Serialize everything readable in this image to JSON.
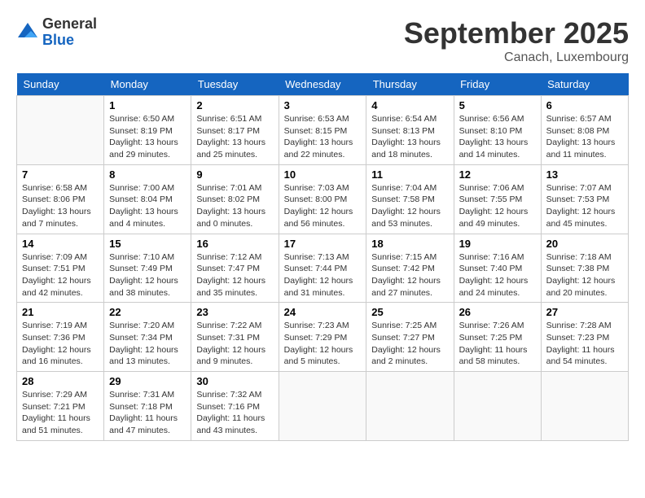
{
  "header": {
    "logo_general": "General",
    "logo_blue": "Blue",
    "month_title": "September 2025",
    "location": "Canach, Luxembourg"
  },
  "days_of_week": [
    "Sunday",
    "Monday",
    "Tuesday",
    "Wednesday",
    "Thursday",
    "Friday",
    "Saturday"
  ],
  "weeks": [
    [
      {
        "day": "",
        "info": ""
      },
      {
        "day": "1",
        "info": "Sunrise: 6:50 AM\nSunset: 8:19 PM\nDaylight: 13 hours\nand 29 minutes."
      },
      {
        "day": "2",
        "info": "Sunrise: 6:51 AM\nSunset: 8:17 PM\nDaylight: 13 hours\nand 25 minutes."
      },
      {
        "day": "3",
        "info": "Sunrise: 6:53 AM\nSunset: 8:15 PM\nDaylight: 13 hours\nand 22 minutes."
      },
      {
        "day": "4",
        "info": "Sunrise: 6:54 AM\nSunset: 8:13 PM\nDaylight: 13 hours\nand 18 minutes."
      },
      {
        "day": "5",
        "info": "Sunrise: 6:56 AM\nSunset: 8:10 PM\nDaylight: 13 hours\nand 14 minutes."
      },
      {
        "day": "6",
        "info": "Sunrise: 6:57 AM\nSunset: 8:08 PM\nDaylight: 13 hours\nand 11 minutes."
      }
    ],
    [
      {
        "day": "7",
        "info": "Sunrise: 6:58 AM\nSunset: 8:06 PM\nDaylight: 13 hours\nand 7 minutes."
      },
      {
        "day": "8",
        "info": "Sunrise: 7:00 AM\nSunset: 8:04 PM\nDaylight: 13 hours\nand 4 minutes."
      },
      {
        "day": "9",
        "info": "Sunrise: 7:01 AM\nSunset: 8:02 PM\nDaylight: 13 hours\nand 0 minutes."
      },
      {
        "day": "10",
        "info": "Sunrise: 7:03 AM\nSunset: 8:00 PM\nDaylight: 12 hours\nand 56 minutes."
      },
      {
        "day": "11",
        "info": "Sunrise: 7:04 AM\nSunset: 7:58 PM\nDaylight: 12 hours\nand 53 minutes."
      },
      {
        "day": "12",
        "info": "Sunrise: 7:06 AM\nSunset: 7:55 PM\nDaylight: 12 hours\nand 49 minutes."
      },
      {
        "day": "13",
        "info": "Sunrise: 7:07 AM\nSunset: 7:53 PM\nDaylight: 12 hours\nand 45 minutes."
      }
    ],
    [
      {
        "day": "14",
        "info": "Sunrise: 7:09 AM\nSunset: 7:51 PM\nDaylight: 12 hours\nand 42 minutes."
      },
      {
        "day": "15",
        "info": "Sunrise: 7:10 AM\nSunset: 7:49 PM\nDaylight: 12 hours\nand 38 minutes."
      },
      {
        "day": "16",
        "info": "Sunrise: 7:12 AM\nSunset: 7:47 PM\nDaylight: 12 hours\nand 35 minutes."
      },
      {
        "day": "17",
        "info": "Sunrise: 7:13 AM\nSunset: 7:44 PM\nDaylight: 12 hours\nand 31 minutes."
      },
      {
        "day": "18",
        "info": "Sunrise: 7:15 AM\nSunset: 7:42 PM\nDaylight: 12 hours\nand 27 minutes."
      },
      {
        "day": "19",
        "info": "Sunrise: 7:16 AM\nSunset: 7:40 PM\nDaylight: 12 hours\nand 24 minutes."
      },
      {
        "day": "20",
        "info": "Sunrise: 7:18 AM\nSunset: 7:38 PM\nDaylight: 12 hours\nand 20 minutes."
      }
    ],
    [
      {
        "day": "21",
        "info": "Sunrise: 7:19 AM\nSunset: 7:36 PM\nDaylight: 12 hours\nand 16 minutes."
      },
      {
        "day": "22",
        "info": "Sunrise: 7:20 AM\nSunset: 7:34 PM\nDaylight: 12 hours\nand 13 minutes."
      },
      {
        "day": "23",
        "info": "Sunrise: 7:22 AM\nSunset: 7:31 PM\nDaylight: 12 hours\nand 9 minutes."
      },
      {
        "day": "24",
        "info": "Sunrise: 7:23 AM\nSunset: 7:29 PM\nDaylight: 12 hours\nand 5 minutes."
      },
      {
        "day": "25",
        "info": "Sunrise: 7:25 AM\nSunset: 7:27 PM\nDaylight: 12 hours\nand 2 minutes."
      },
      {
        "day": "26",
        "info": "Sunrise: 7:26 AM\nSunset: 7:25 PM\nDaylight: 11 hours\nand 58 minutes."
      },
      {
        "day": "27",
        "info": "Sunrise: 7:28 AM\nSunset: 7:23 PM\nDaylight: 11 hours\nand 54 minutes."
      }
    ],
    [
      {
        "day": "28",
        "info": "Sunrise: 7:29 AM\nSunset: 7:21 PM\nDaylight: 11 hours\nand 51 minutes."
      },
      {
        "day": "29",
        "info": "Sunrise: 7:31 AM\nSunset: 7:18 PM\nDaylight: 11 hours\nand 47 minutes."
      },
      {
        "day": "30",
        "info": "Sunrise: 7:32 AM\nSunset: 7:16 PM\nDaylight: 11 hours\nand 43 minutes."
      },
      {
        "day": "",
        "info": ""
      },
      {
        "day": "",
        "info": ""
      },
      {
        "day": "",
        "info": ""
      },
      {
        "day": "",
        "info": ""
      }
    ]
  ]
}
